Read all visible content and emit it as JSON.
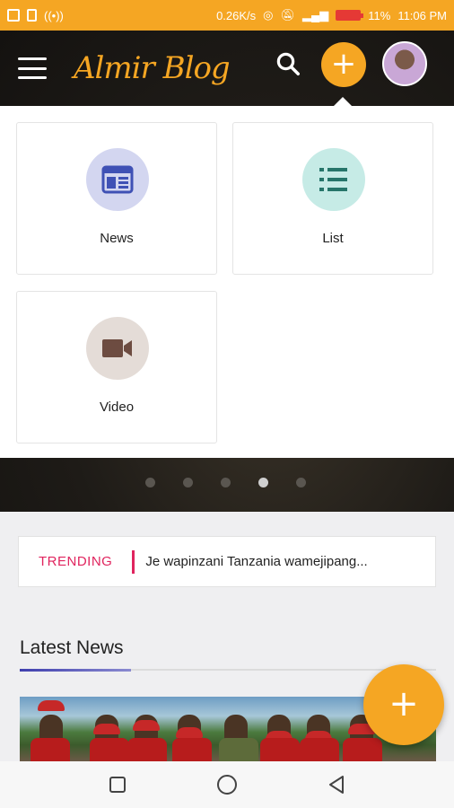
{
  "status_bar": {
    "net_speed": "0.26K/s",
    "battery": "11%",
    "time": "11:06 PM",
    "battery_color": "#e53935",
    "bg_color": "#f5a623"
  },
  "header": {
    "logo": "Almir Blog",
    "menu_icon": "hamburger-icon",
    "search_icon": "search-icon",
    "add_icon": "plus-icon",
    "accent": "#f5a623"
  },
  "popup": {
    "items": [
      {
        "label": "News",
        "icon": "newspaper-icon",
        "circle_color": "#d3d6f0",
        "icon_color": "#3f51b5"
      },
      {
        "label": "List",
        "icon": "list-icon",
        "circle_color": "#c6ebe6",
        "icon_color": "#26756a"
      },
      {
        "label": "Video",
        "icon": "video-camera-icon",
        "circle_color": "#e4dcd7",
        "icon_color": "#6d4c41"
      }
    ]
  },
  "carousel": {
    "count": 5,
    "active_index": 3
  },
  "trending": {
    "label": "TRENDING",
    "headline": "Je wapinzani Tanzania wamejipang...",
    "accent": "#e0245e"
  },
  "latest": {
    "title": "Latest News"
  },
  "fab": {
    "icon": "plus-icon"
  },
  "nav": {
    "items": [
      "recent-apps-icon",
      "home-icon",
      "back-icon"
    ]
  }
}
